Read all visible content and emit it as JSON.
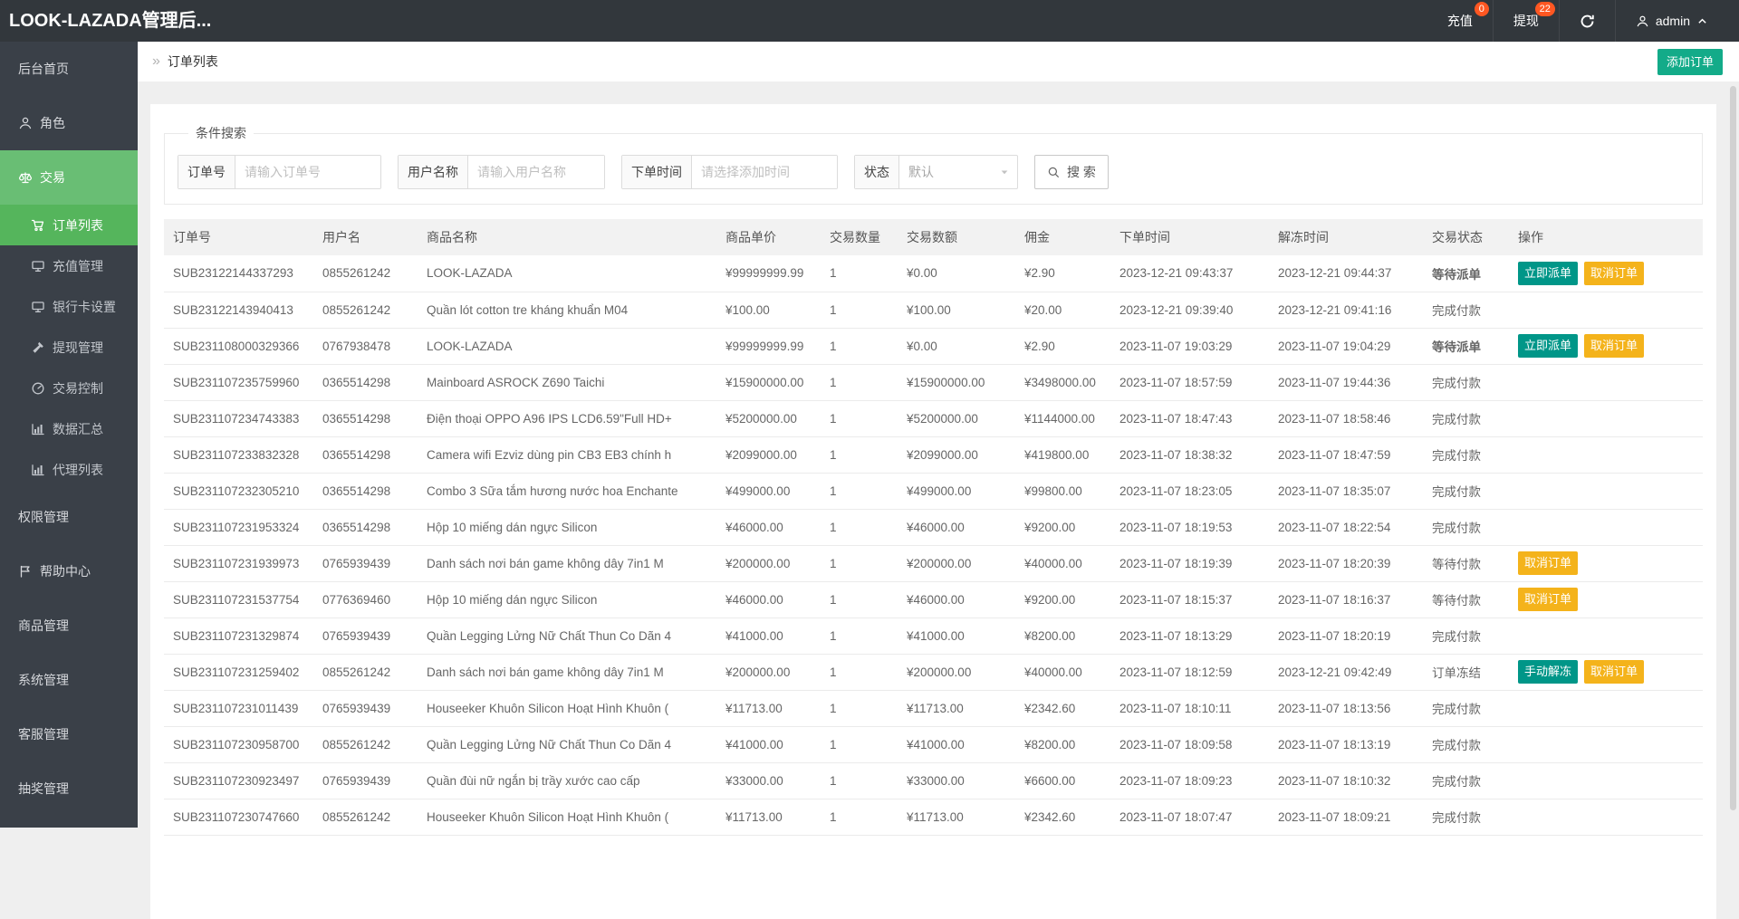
{
  "topbar": {
    "title": "LOOK-LAZADA管理后...",
    "recharge": {
      "label": "充值",
      "badge": "0"
    },
    "withdraw": {
      "label": "提现",
      "badge": "22"
    },
    "user": {
      "name": "admin"
    }
  },
  "breadcrumb": {
    "arrow": "»",
    "title": "订单列表"
  },
  "page_actions": {
    "add_order": "添加订单"
  },
  "sidebar": {
    "items": [
      {
        "label": "后台首页",
        "type": "group"
      },
      {
        "label": "角色",
        "icon": "user",
        "type": "group"
      },
      {
        "label": "交易",
        "icon": "scales",
        "type": "group",
        "state": "open"
      },
      {
        "label": "订单列表",
        "icon": "cart",
        "type": "sub",
        "state": "active"
      },
      {
        "label": "充值管理",
        "icon": "monitor",
        "type": "sub"
      },
      {
        "label": "银行卡设置",
        "icon": "monitor",
        "type": "sub"
      },
      {
        "label": "提现管理",
        "icon": "hammer",
        "type": "sub"
      },
      {
        "label": "交易控制",
        "icon": "gauge",
        "type": "sub"
      },
      {
        "label": "数据汇总",
        "icon": "chart",
        "type": "sub"
      },
      {
        "label": "代理列表",
        "icon": "chart",
        "type": "sub"
      },
      {
        "label": "权限管理",
        "type": "group"
      },
      {
        "label": "帮助中心",
        "icon": "flag",
        "type": "group"
      },
      {
        "label": "商品管理",
        "type": "group"
      },
      {
        "label": "系统管理",
        "type": "group"
      },
      {
        "label": "客服管理",
        "type": "group"
      },
      {
        "label": "抽奖管理",
        "type": "group"
      }
    ]
  },
  "search": {
    "legend": "条件搜索",
    "order_no": {
      "label": "订单号",
      "placeholder": "请输入订单号"
    },
    "user_name": {
      "label": "用户名称",
      "placeholder": "请输入用户名称"
    },
    "order_time": {
      "label": "下单时间",
      "placeholder": "请选择添加时间"
    },
    "status": {
      "label": "状态",
      "value": "默认"
    },
    "button": "搜 索"
  },
  "table": {
    "columns": [
      "订单号",
      "用户名",
      "商品名称",
      "商品单价",
      "交易数量",
      "交易数额",
      "佣金",
      "下单时间",
      "解冻时间",
      "交易状态",
      "操作"
    ],
    "rows": [
      {
        "order_no": "SUB23122144337293",
        "user": "0855261242",
        "product": "LOOK-LAZADA",
        "price": "¥99999999.99",
        "qty": "1",
        "amount": "¥0.00",
        "commission": "¥2.90",
        "order_time": "2023-12-21 09:43:37",
        "unfreeze_time": "2023-12-21 09:44:37",
        "status": "等待派单",
        "status_style": "red",
        "actions": [
          {
            "label": "立即派单",
            "style": "teal"
          },
          {
            "label": "取消订单",
            "style": "yellow"
          }
        ]
      },
      {
        "order_no": "SUB23122143940413",
        "user": "0855261242",
        "product": "Quần lót cotton tre kháng khuẩn M04",
        "price": "¥100.00",
        "qty": "1",
        "amount": "¥100.00",
        "commission": "¥20.00",
        "order_time": "2023-12-21 09:39:40",
        "unfreeze_time": "2023-12-21 09:41:16",
        "status": "完成付款",
        "status_style": "normal",
        "actions": []
      },
      {
        "order_no": "SUB231108000329366",
        "user": "0767938478",
        "product": "LOOK-LAZADA",
        "price": "¥99999999.99",
        "qty": "1",
        "amount": "¥0.00",
        "commission": "¥2.90",
        "order_time": "2023-11-07 19:03:29",
        "unfreeze_time": "2023-11-07 19:04:29",
        "status": "等待派单",
        "status_style": "red",
        "actions": [
          {
            "label": "立即派单",
            "style": "teal"
          },
          {
            "label": "取消订单",
            "style": "yellow"
          }
        ]
      },
      {
        "order_no": "SUB231107235759960",
        "user": "0365514298",
        "product": "Mainboard ASROCK Z690 Taichi",
        "price": "¥15900000.00",
        "qty": "1",
        "amount": "¥15900000.00",
        "commission": "¥3498000.00",
        "order_time": "2023-11-07 18:57:59",
        "unfreeze_time": "2023-11-07 19:44:36",
        "status": "完成付款",
        "status_style": "normal",
        "actions": []
      },
      {
        "order_no": "SUB231107234743383",
        "user": "0365514298",
        "product": "Điện thoại OPPO A96 IPS LCD6.59\"Full HD+",
        "price": "¥5200000.00",
        "qty": "1",
        "amount": "¥5200000.00",
        "commission": "¥1144000.00",
        "order_time": "2023-11-07 18:47:43",
        "unfreeze_time": "2023-11-07 18:58:46",
        "status": "完成付款",
        "status_style": "normal",
        "actions": []
      },
      {
        "order_no": "SUB231107233832328",
        "user": "0365514298",
        "product": "Camera wifi Ezviz dùng pin CB3 EB3 chính h",
        "price": "¥2099000.00",
        "qty": "1",
        "amount": "¥2099000.00",
        "commission": "¥419800.00",
        "order_time": "2023-11-07 18:38:32",
        "unfreeze_time": "2023-11-07 18:47:59",
        "status": "完成付款",
        "status_style": "normal",
        "actions": []
      },
      {
        "order_no": "SUB231107232305210",
        "user": "0365514298",
        "product": "Combo 3 Sữa tắm hương nước hoa Enchante",
        "price": "¥499000.00",
        "qty": "1",
        "amount": "¥499000.00",
        "commission": "¥99800.00",
        "order_time": "2023-11-07 18:23:05",
        "unfreeze_time": "2023-11-07 18:35:07",
        "status": "完成付款",
        "status_style": "normal",
        "actions": []
      },
      {
        "order_no": "SUB231107231953324",
        "user": "0365514298",
        "product": "Hộp 10 miếng dán ngực Silicon",
        "price": "¥46000.00",
        "qty": "1",
        "amount": "¥46000.00",
        "commission": "¥9200.00",
        "order_time": "2023-11-07 18:19:53",
        "unfreeze_time": "2023-11-07 18:22:54",
        "status": "完成付款",
        "status_style": "normal",
        "actions": []
      },
      {
        "order_no": "SUB231107231939973",
        "user": "0765939439",
        "product": "Danh sách nơi bán game không dây 7in1 M",
        "price": "¥200000.00",
        "qty": "1",
        "amount": "¥200000.00",
        "commission": "¥40000.00",
        "order_time": "2023-11-07 18:19:39",
        "unfreeze_time": "2023-11-07 18:20:39",
        "status": "等待付款",
        "status_style": "normal",
        "actions": [
          {
            "label": "取消订单",
            "style": "yellow"
          }
        ]
      },
      {
        "order_no": "SUB231107231537754",
        "user": "0776369460",
        "product": "Hộp 10 miếng dán ngực Silicon",
        "price": "¥46000.00",
        "qty": "1",
        "amount": "¥46000.00",
        "commission": "¥9200.00",
        "order_time": "2023-11-07 18:15:37",
        "unfreeze_time": "2023-11-07 18:16:37",
        "status": "等待付款",
        "status_style": "normal",
        "actions": [
          {
            "label": "取消订单",
            "style": "yellow"
          }
        ]
      },
      {
        "order_no": "SUB231107231329874",
        "user": "0765939439",
        "product": "Quần Legging Lửng Nữ Chất Thun Co Dãn 4",
        "price": "¥41000.00",
        "qty": "1",
        "amount": "¥41000.00",
        "commission": "¥8200.00",
        "order_time": "2023-11-07 18:13:29",
        "unfreeze_time": "2023-11-07 18:20:19",
        "status": "完成付款",
        "status_style": "normal",
        "actions": []
      },
      {
        "order_no": "SUB231107231259402",
        "user": "0855261242",
        "product": "Danh sách nơi bán game không dây 7in1 M",
        "price": "¥200000.00",
        "qty": "1",
        "amount": "¥200000.00",
        "commission": "¥40000.00",
        "order_time": "2023-11-07 18:12:59",
        "unfreeze_time": "2023-12-21 09:42:49",
        "status": "订单冻结",
        "status_style": "normal",
        "actions": [
          {
            "label": "手动解冻",
            "style": "teal"
          },
          {
            "label": "取消订单",
            "style": "yellow"
          }
        ]
      },
      {
        "order_no": "SUB231107231011439",
        "user": "0765939439",
        "product": "Houseeker Khuôn Silicon Hoạt Hình Khuôn (",
        "price": "¥11713.00",
        "qty": "1",
        "amount": "¥11713.00",
        "commission": "¥2342.60",
        "order_time": "2023-11-07 18:10:11",
        "unfreeze_time": "2023-11-07 18:13:56",
        "status": "完成付款",
        "status_style": "normal",
        "actions": []
      },
      {
        "order_no": "SUB231107230958700",
        "user": "0855261242",
        "product": "Quần Legging Lửng Nữ Chất Thun Co Dãn 4",
        "price": "¥41000.00",
        "qty": "1",
        "amount": "¥41000.00",
        "commission": "¥8200.00",
        "order_time": "2023-11-07 18:09:58",
        "unfreeze_time": "2023-11-07 18:13:19",
        "status": "完成付款",
        "status_style": "normal",
        "actions": []
      },
      {
        "order_no": "SUB231107230923497",
        "user": "0765939439",
        "product": "Quần đùi nữ ngắn bị trầy xước cao cấp",
        "price": "¥33000.00",
        "qty": "1",
        "amount": "¥33000.00",
        "commission": "¥6600.00",
        "order_time": "2023-11-07 18:09:23",
        "unfreeze_time": "2023-11-07 18:10:32",
        "status": "完成付款",
        "status_style": "normal",
        "actions": []
      },
      {
        "order_no": "SUB231107230747660",
        "user": "0855261242",
        "product": "Houseeker Khuôn Silicon Hoạt Hình Khuôn (",
        "price": "¥11713.00",
        "qty": "1",
        "amount": "¥11713.00",
        "commission": "¥2342.60",
        "order_time": "2023-11-07 18:07:47",
        "unfreeze_time": "2023-11-07 18:09:21",
        "status": "完成付款",
        "status_style": "normal",
        "actions": []
      }
    ]
  },
  "colors": {
    "topbar_bg": "#32373c",
    "sidebar_bg": "#3a4048",
    "group_open_green": "#69be74",
    "active_item_green": "#55b55c",
    "badge_orange": "#ff5722",
    "add_button_teal": "#13ab89",
    "action_teal": "#009688",
    "action_yellow": "#f4b31b",
    "status_red": "#f00000"
  }
}
